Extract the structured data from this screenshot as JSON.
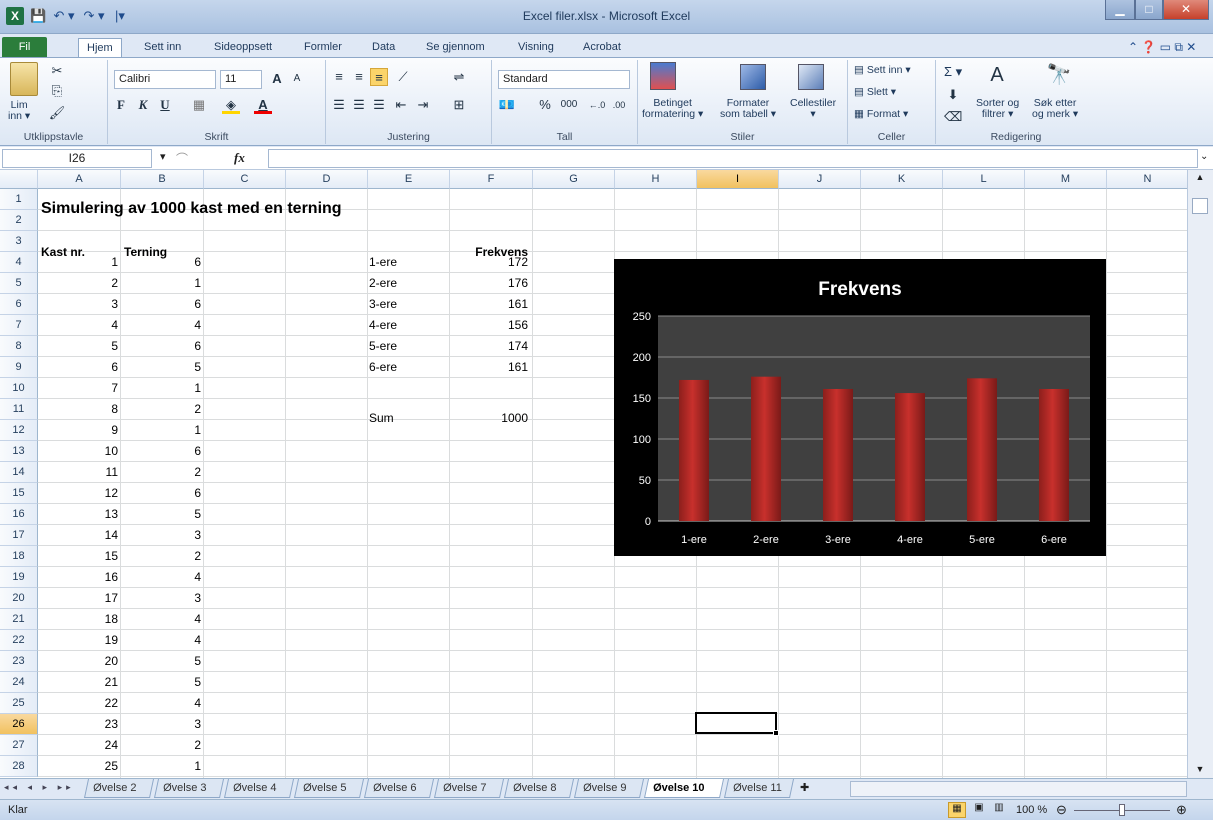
{
  "window": {
    "title": "Excel filer.xlsx - Microsoft Excel"
  },
  "qat": {
    "save": "💾",
    "undo": "↶ ▾",
    "redo": "↷ ▾",
    "customize": "|▾"
  },
  "tabs": [
    "Fil",
    "Hjem",
    "Sett inn",
    "Sideoppsett",
    "Formler",
    "Data",
    "Se gjennom",
    "Visning",
    "Acrobat"
  ],
  "ribbon": {
    "clipboard": {
      "paste": "Lim\ninn ▾",
      "label": "Utklippstavle"
    },
    "font": {
      "name": "Calibri",
      "size": "11",
      "bold": "F",
      "italic": "K",
      "underline": "U",
      "label": "Skrift"
    },
    "alignment": {
      "label": "Justering"
    },
    "number": {
      "format": "Standard",
      "percent": "%",
      "thousands": "000",
      "label": "Tall"
    },
    "styles": {
      "conditional": "Betinget\nformatering ▾",
      "table": "Formater\nsom tabell ▾",
      "cell": "Cellestiler\n▾",
      "label": "Stiler"
    },
    "cells": {
      "insert": "Sett inn ▾",
      "delete": "Slett ▾",
      "format": "Format ▾",
      "label": "Celler"
    },
    "editing": {
      "sigma": "Σ ▾",
      "sort": "Sorter og\nfiltrer ▾",
      "find": "Søk etter\nog merk ▾",
      "label": "Redigering"
    }
  },
  "formula_bar": {
    "name_box": "I26",
    "fx": "fx",
    "content": ""
  },
  "columns": [
    "A",
    "B",
    "C",
    "D",
    "E",
    "F",
    "G",
    "H",
    "I",
    "J",
    "K",
    "L",
    "M",
    "N"
  ],
  "selected": {
    "column": "I",
    "row": "26"
  },
  "sheet": {
    "title": "Simulering av 1000 kast med en terning",
    "header_a": "Kast nr.",
    "header_b": "Terning",
    "header_f": "Frekvens",
    "rows": [
      {
        "n": "1",
        "d": "6"
      },
      {
        "n": "2",
        "d": "1"
      },
      {
        "n": "3",
        "d": "6"
      },
      {
        "n": "4",
        "d": "4"
      },
      {
        "n": "5",
        "d": "6"
      },
      {
        "n": "6",
        "d": "5"
      },
      {
        "n": "7",
        "d": "1"
      },
      {
        "n": "8",
        "d": "2"
      },
      {
        "n": "9",
        "d": "1"
      },
      {
        "n": "10",
        "d": "6"
      },
      {
        "n": "11",
        "d": "2"
      },
      {
        "n": "12",
        "d": "6"
      },
      {
        "n": "13",
        "d": "5"
      },
      {
        "n": "14",
        "d": "3"
      },
      {
        "n": "15",
        "d": "2"
      },
      {
        "n": "16",
        "d": "4"
      },
      {
        "n": "17",
        "d": "3"
      },
      {
        "n": "18",
        "d": "4"
      },
      {
        "n": "19",
        "d": "4"
      },
      {
        "n": "20",
        "d": "5"
      },
      {
        "n": "21",
        "d": "5"
      },
      {
        "n": "22",
        "d": "4"
      },
      {
        "n": "23",
        "d": "3"
      },
      {
        "n": "24",
        "d": "2"
      },
      {
        "n": "25",
        "d": "1"
      }
    ],
    "freq": [
      {
        "label": "1-ere",
        "value": "172"
      },
      {
        "label": "2-ere",
        "value": "176"
      },
      {
        "label": "3-ere",
        "value": "161"
      },
      {
        "label": "4-ere",
        "value": "156"
      },
      {
        "label": "5-ere",
        "value": "174"
      },
      {
        "label": "6-ere",
        "value": "161"
      }
    ],
    "sum_label": "Sum",
    "sum_value": "1000"
  },
  "chart_data": {
    "type": "bar",
    "title": "Frekvens",
    "categories": [
      "1-ere",
      "2-ere",
      "3-ere",
      "4-ere",
      "5-ere",
      "6-ere"
    ],
    "values": [
      172,
      176,
      161,
      156,
      174,
      161
    ],
    "ylim": [
      0,
      250
    ],
    "yticks": [
      "0",
      "50",
      "100",
      "150",
      "200",
      "250"
    ],
    "grid": true,
    "bar_color": "#c8302c",
    "plot_bg": "#404040"
  },
  "sheet_tabs": [
    "Øvelse 2",
    "Øvelse 3",
    "Øvelse 4",
    "Øvelse 5",
    "Øvelse 6",
    "Øvelse 7",
    "Øvelse 8",
    "Øvelse 9",
    "Øvelse 10",
    "Øvelse 11"
  ],
  "active_sheet": "Øvelse 10",
  "status": {
    "mode": "Klar",
    "zoom": "100 %"
  }
}
